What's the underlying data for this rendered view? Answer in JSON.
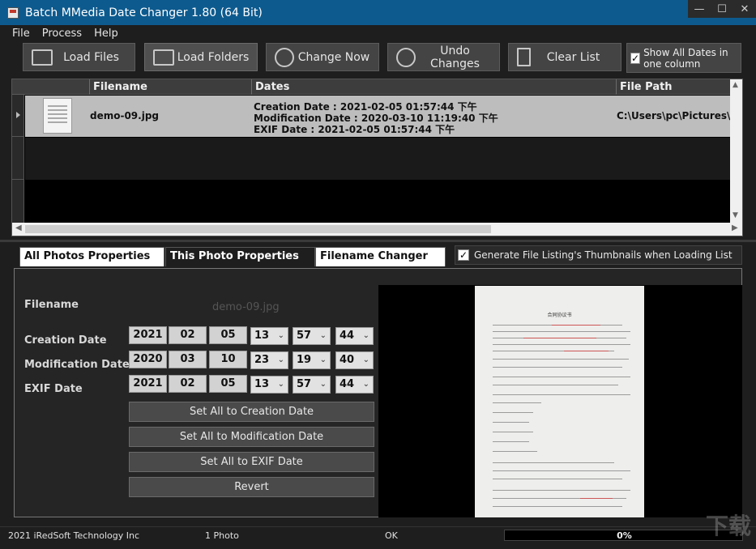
{
  "window": {
    "title": "Batch MMedia Date Changer 1.80 (64 Bit)",
    "min": "—",
    "max": "☐",
    "close": "✕"
  },
  "menu": [
    "File",
    "Process",
    "Help"
  ],
  "toolbar": {
    "load_files": "Load Files",
    "load_folders": "Load Folders",
    "change_now": "Change Now",
    "undo_changes": "Undo Changes",
    "clear_list": "Clear List",
    "show_all_dates": "Show All Dates in one column",
    "show_all_dates_checked": "✓"
  },
  "grid": {
    "columns": [
      "Filename",
      "Dates",
      "File Path"
    ],
    "rows": [
      {
        "filename": "demo-09.jpg",
        "creation": "Creation Date : 2021-02-05 01:57:44 下午",
        "modification": "Modification Date : 2020-03-10 11:19:40 下午",
        "exif": "EXIF Date : 2021-02-05 01:57:44 下午",
        "path": "C:\\Users\\pc\\Pictures\\d"
      }
    ]
  },
  "tabs": {
    "all": "All Photos Properties",
    "this": "This Photo Properties",
    "filename_changer": "Filename Changer",
    "gen_thumbs": "Generate File Listing's Thumbnails when Loading List",
    "gen_thumbs_checked": "✓"
  },
  "props": {
    "filename_label": "Filename",
    "filename_value": "demo-09.jpg",
    "creation_label": "Creation Date",
    "modification_label": "Modification Date",
    "exif_label": "EXIF Date",
    "creation": {
      "year": "2021",
      "month": "02",
      "day": "05",
      "hour": "13",
      "minute": "57",
      "second": "44"
    },
    "modification": {
      "year": "2020",
      "month": "03",
      "day": "10",
      "hour": "23",
      "minute": "19",
      "second": "40"
    },
    "exif": {
      "year": "2021",
      "month": "02",
      "day": "05",
      "hour": "13",
      "minute": "57",
      "second": "44"
    },
    "set_creation": "Set All to Creation Date",
    "set_modification": "Set All to Modification Date",
    "set_exif": "Set All to EXIF Date",
    "revert": "Revert",
    "preview_doc_title": "合同协议书"
  },
  "status": {
    "company": "2021 iRedSoft Technology Inc",
    "count": "1 Photo",
    "state": "OK",
    "progress": "0%",
    "progress_value": 0,
    "watermark": "下载"
  },
  "colors": {
    "titlebar": "#0d5a8e",
    "row_selected": "#bdbdbd",
    "progress": "#2f9e44"
  }
}
